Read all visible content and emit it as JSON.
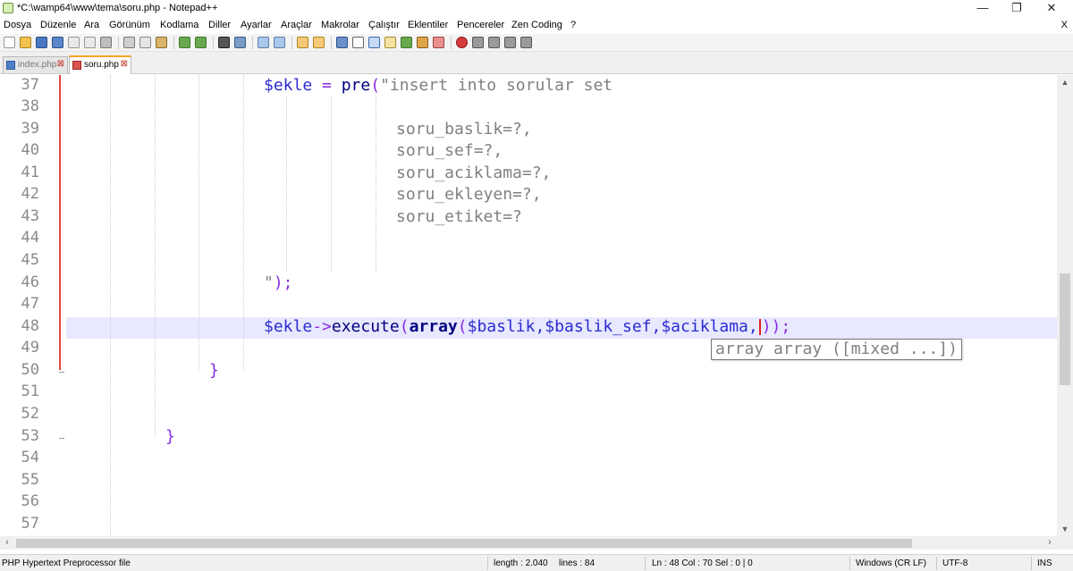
{
  "window": {
    "title": "*C:\\wamp64\\www\\tema\\soru.php - Notepad++",
    "minimize": "—",
    "restore": "❐",
    "close": "✕"
  },
  "menu": {
    "items": [
      "Dosya",
      "Düzenle",
      "Ara",
      "Görünüm",
      "Kodlama",
      "Diller",
      "Ayarlar",
      "Araçlar",
      "Makrolar",
      "Çalıştır",
      "Eklentiler",
      "Pencereler",
      "Zen Coding",
      "?"
    ],
    "close": "X"
  },
  "toolbar": {
    "icons": [
      "new-icon",
      "open-icon",
      "save-icon",
      "save-all-icon",
      "close-icon",
      "close-all-icon",
      "print-icon",
      "cut-icon",
      "copy-icon",
      "paste-icon",
      "undo-icon",
      "redo-icon",
      "find-icon",
      "replace-icon",
      "zoom-in-icon",
      "zoom-out-icon",
      "sync-v-icon",
      "sync-h-icon",
      "word-wrap-icon",
      "show-all-icon",
      "indent-guide-icon",
      "doc-map-icon",
      "function-list-icon",
      "folder-icon",
      "monitor-icon",
      "record-icon",
      "stop-icon",
      "play-icon",
      "run-multiple-icon",
      "save-macro-icon"
    ]
  },
  "tabs": [
    {
      "label": "index.php",
      "close": "⊠",
      "active": false
    },
    {
      "label": "soru.php",
      "close": "⊠",
      "active": true
    }
  ],
  "editor": {
    "line_numbers": [
      "37",
      "38",
      "39",
      "40",
      "41",
      "42",
      "43",
      "44",
      "45",
      "46",
      "47",
      "48",
      "49",
      "50",
      "51",
      "52",
      "53",
      "54",
      "55",
      "56",
      "57"
    ],
    "line37": {
      "var": "$ekle",
      "eq": " = ",
      "fn": "pre",
      "paren": "(",
      "str": "\"insert into sorular set"
    },
    "line39": "soru_baslik=?,",
    "line40": "soru_sef=?,",
    "line41": "soru_aciklama=?,",
    "line42": "soru_ekleyen=?,",
    "line43": "soru_etiket=?",
    "line46": {
      "str": "\"",
      "rest": ");"
    },
    "line48": {
      "var": "$ekle",
      "arrow": "->",
      "fn": "execute",
      "p1": "(",
      "kw": "array",
      "p2": "(",
      "args": "$baslik,$baslik_sef,$aciklama,",
      "close": "));"
    },
    "line50": "}",
    "line53": "}",
    "calltip": "array array ([mixed ...])"
  },
  "status": {
    "filetype": "PHP Hypertext Preprocessor file",
    "length": "length : 2.040",
    "lines": "lines : 84",
    "position": "Ln : 48    Col : 70    Sel : 0 | 0",
    "eol": "Windows (CR LF)",
    "encoding": "UTF-8",
    "mode": "INS"
  }
}
